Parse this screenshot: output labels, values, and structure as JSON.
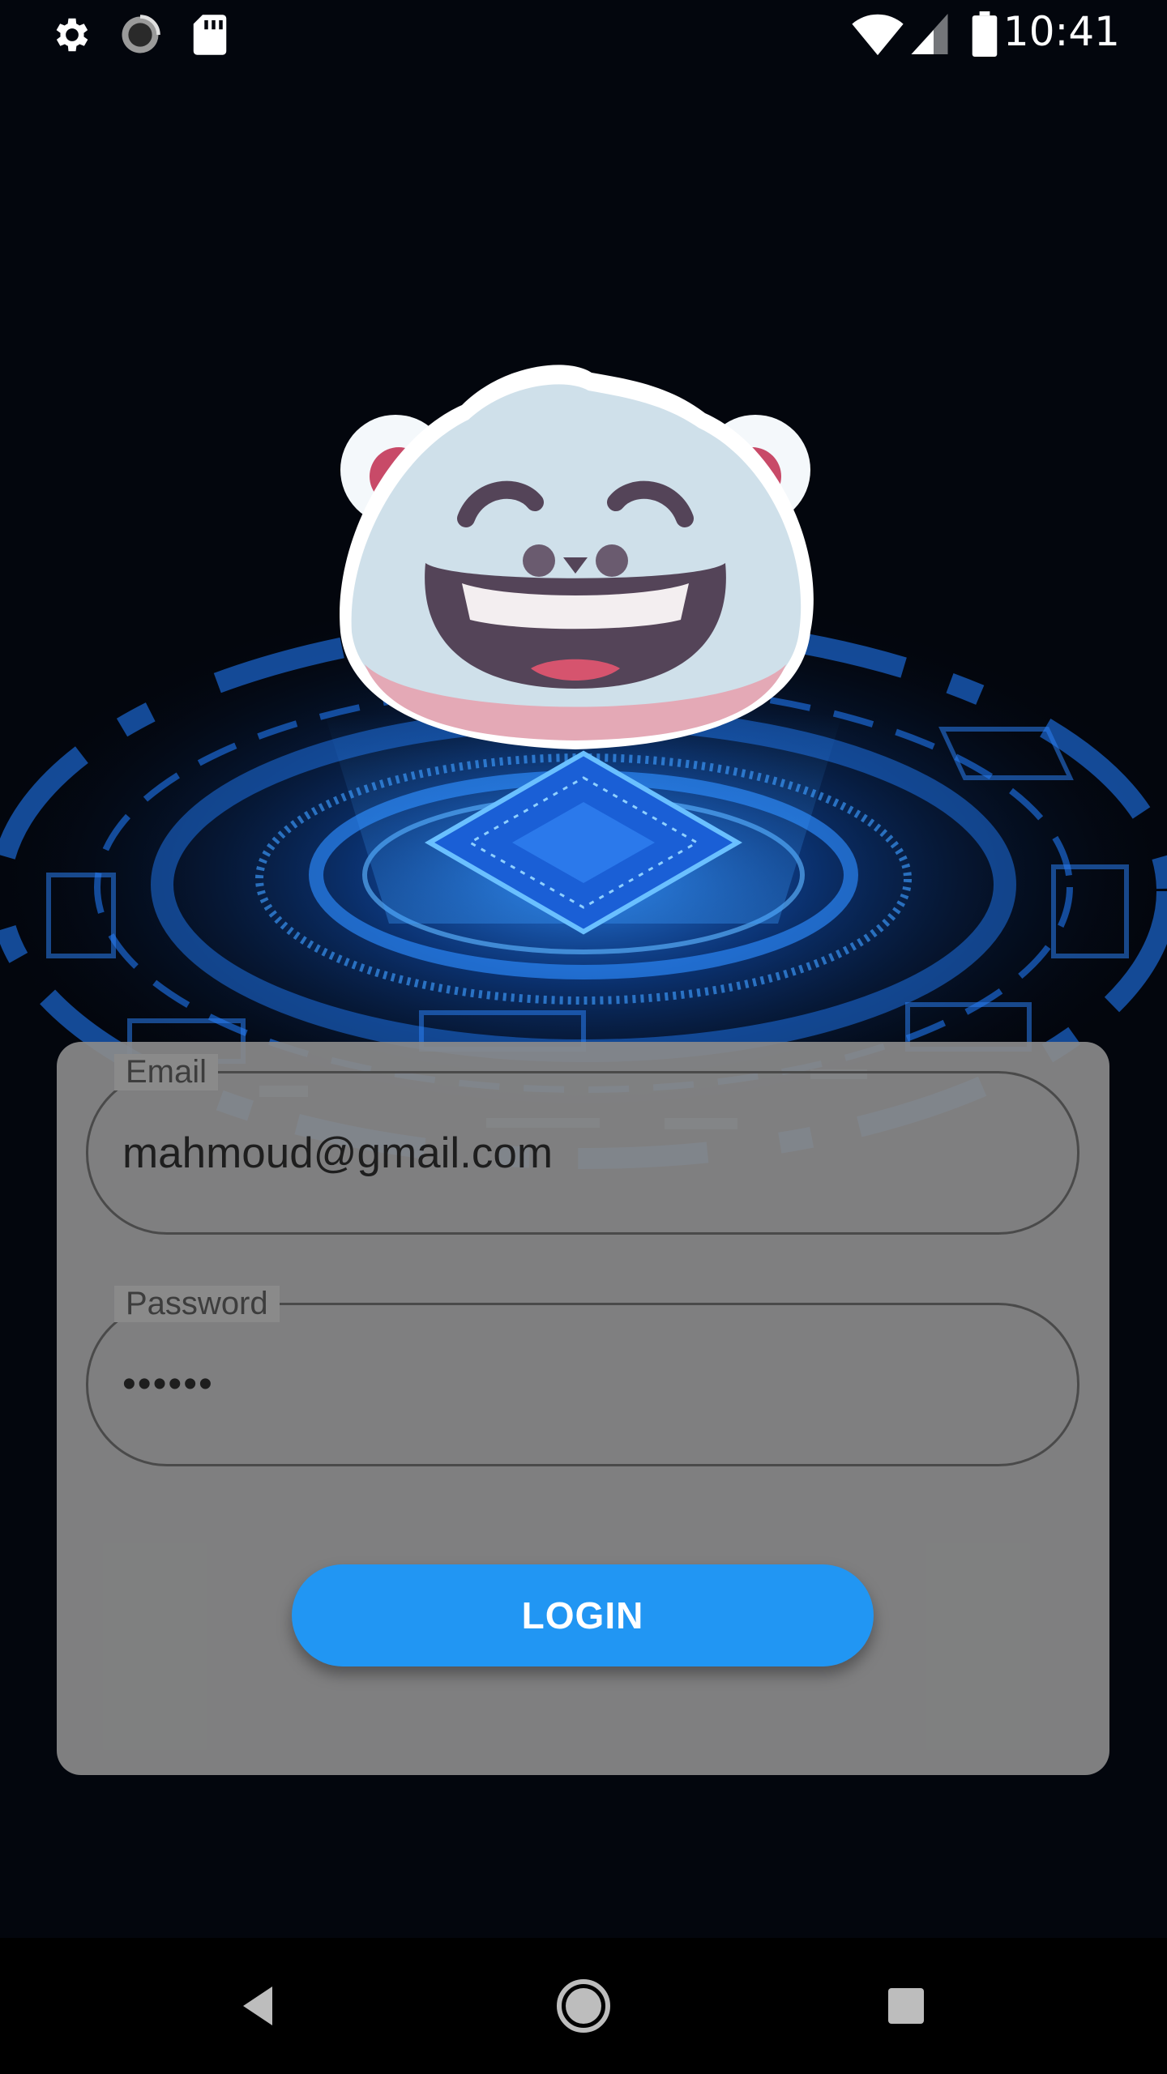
{
  "status_bar": {
    "time": "10:41",
    "left_icons": [
      "settings-icon",
      "sync-icon",
      "sd-card-icon"
    ],
    "right_icons": [
      "wifi-icon",
      "signal-icon",
      "battery-icon"
    ]
  },
  "hero": {
    "mascot": "polar-bear-mascot",
    "background": "blue-tech-circuit-rings"
  },
  "login_form": {
    "email": {
      "label": "Email",
      "value": "mahmoud@gmail.com"
    },
    "password": {
      "label": "Password",
      "value": "••••••"
    },
    "login_label": "LOGIN"
  },
  "nav_bar": {
    "buttons": [
      "back-icon",
      "home-icon",
      "recents-icon"
    ]
  },
  "colors": {
    "background": "#03060d",
    "card": "#8a8a8a",
    "accent": "#2196f3",
    "glow": "#1e88ff"
  }
}
